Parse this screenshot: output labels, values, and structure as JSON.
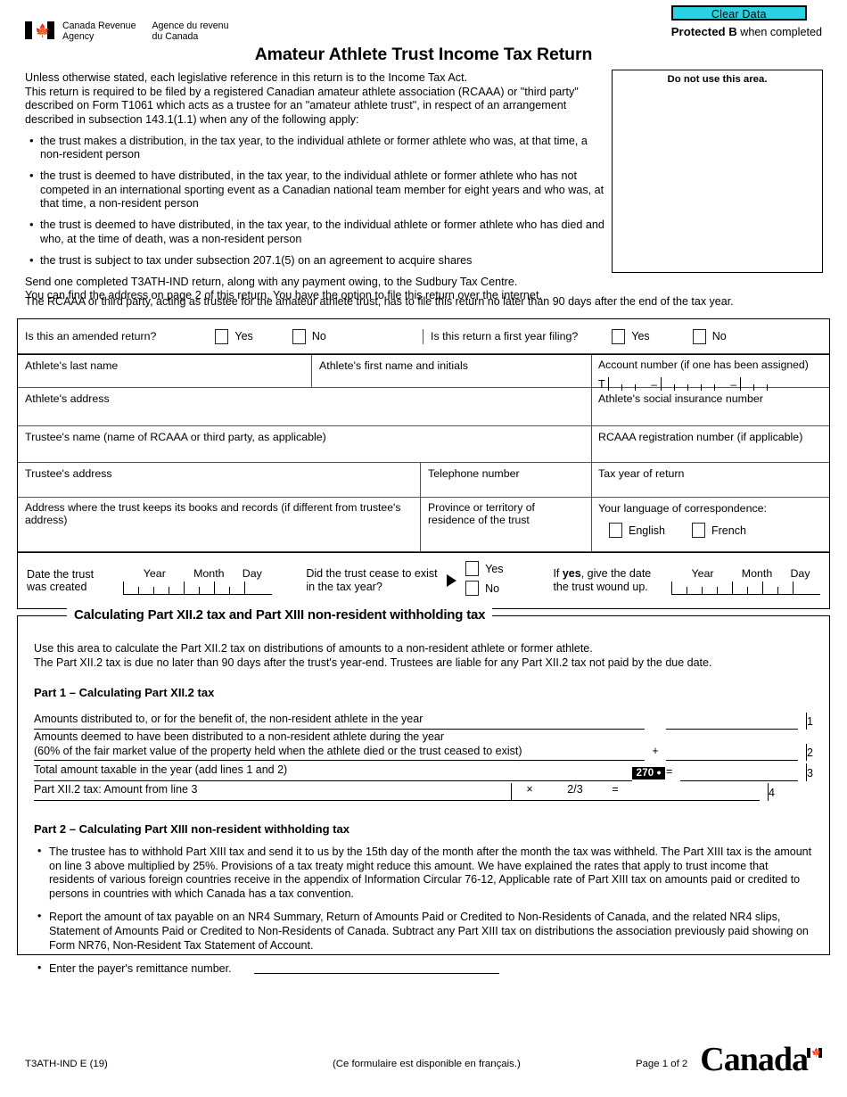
{
  "header": {
    "clear_data_label": "Clear Data",
    "clear_data_color": "#2ad2e3",
    "protected_bold": "Protected B",
    "protected_rest": " when completed",
    "agency_en_line1": "Canada Revenue",
    "agency_en_line2": "Agency",
    "agency_fr_line1": "Agence du revenu",
    "agency_fr_line2": "du Canada",
    "title": "Amateur Athlete Trust Income Tax Return"
  },
  "intro": {
    "line1": "Unless otherwise stated, each legislative reference in this return is to the Income Tax Act.",
    "line2": "This return is required to be filed by a registered Canadian amateur athlete association (RCAAA) or \"third party\" described on Form T1061 which acts as a trustee for an \"amateur athlete trust\", in respect of an arrangement described in subsection 143.1(1.1) when any of the following apply:",
    "bullets": [
      "the trust makes a distribution, in the tax year, to the individual athlete or former athlete who was, at that time, a non-resident person",
      "the trust is deemed to have distributed, in the tax year, to the individual athlete or former athlete who has not competed in an international sporting event as a Canadian national team member for eight years and who was, at that time, a non-resident person",
      "the trust is deemed to have distributed, in the tax year, to the individual athlete or former athlete who has died and who, at the time of death, was a non-resident person",
      "the trust is subject to tax under subsection 207.1(5) on an agreement to acquire shares"
    ],
    "send_line1": "Send one completed T3ATH-IND return, along with any payment owing, to the Sudbury Tax Centre.",
    "send_line2": "You can find the address on page 2 of this return. You have the option to file this return over the internet.",
    "rcaaa_line": "The RCAAA or third party, acting as trustee for the amateur athlete trust, has to file this return no later than 90 days after the end of the tax year."
  },
  "do_not_use": {
    "label": "Do not use this area."
  },
  "identification": {
    "amended_question": "Is this an amended return?",
    "amended_yes": "Yes",
    "amended_no": "No",
    "firstyear_question": "Is this return a first year filing?",
    "firstyear_yes": "Yes",
    "firstyear_no": "No",
    "athlete_last_name": "Athlete's last name",
    "athlete_first_name": "Athlete's first name and initials",
    "account_number": "Account number (if one has been assigned)",
    "account_prefix": "T",
    "account_dash": "–",
    "athlete_address": "Athlete's address",
    "athlete_sin": "Athlete's social insurance number",
    "trustee_name": "Trustee's name (name of RCAAA or third party, as applicable)",
    "rcaaa_reg_number": "RCAAA registration number (if applicable)",
    "trustee_address": "Trustee's address",
    "telephone_number": "Telephone number",
    "tax_year": "Tax year of return",
    "books_address": "Address where the trust keeps its books and records (if different from trustee's address)",
    "province_residence": "Province or territory of residence of the trust",
    "language_label": "Your language of correspondence:",
    "language_english": "English",
    "language_french": "French",
    "date_created_label": "Date the trust was created",
    "date_year": "Year",
    "date_month": "Month",
    "date_day": "Day",
    "cease_question": "Did the trust cease to exist in the tax year?",
    "cease_yes": "Yes",
    "cease_no": "No",
    "wound_up_bold": "If yes",
    "wound_up_rest": ", give the date the trust wound up.",
    "wound_up_line1_pre": "If ",
    "wound_up_line1_b": "yes",
    "wound_up_line1_post": ", give the date",
    "wound_up_line2": "the trust wound up."
  },
  "calc": {
    "legend": "Calculating Part XII.2 tax and Part XIII non-resident withholding tax",
    "intro_line1": "Use this area to calculate the Part XII.2 tax on distributions of amounts to a non-resident athlete or former athlete.",
    "intro_line2": "The Part XII.2 tax is due no later than 90 days after the trust's year-end. Trustees are liable for any Part XII.2 tax not paid by the due date.",
    "part1_heading": "Part 1 – Calculating Part XII.2 tax",
    "line1_text": "Amounts distributed to, or for the benefit of, the non-resident athlete in the year",
    "line1_no": "1",
    "line2_text_a": "Amounts deemed to have been distributed to a non-resident athlete during the year",
    "line2_text_b": "(60% of the fair market value of the property held when the athlete died or the trust ceased to exist)",
    "line2_op": "+",
    "line2_no": "2",
    "line3_text": "Total amount taxable in the year (add lines 1 and 2)",
    "line3_tag": "270",
    "line3_op": "=",
    "line3_no": "3",
    "line4_text": "Part XII.2 tax:  Amount from line 3",
    "line4_mult": "×",
    "line4_factor": "2/3",
    "line4_op": "=",
    "line4_no": "4",
    "part2_heading": "Part 2 – Calculating Part XIII non-resident withholding tax",
    "part2_bullets": [
      "The trustee has to withhold Part XIII tax and send it to us by the 15th day of the month after the month the tax was withheld. The Part XIII tax is the amount on line 3 above multiplied by 25%. Provisions of a tax treaty might reduce this amount. We have explained the rates that apply to trust income that residents of various foreign countries receive in the appendix of Information Circular 76-12, Applicable rate of Part XIII tax on amounts paid or credited to persons in countries with which Canada has a tax convention.",
      "Report the amount of tax payable on an NR4 Summary, Return of Amounts Paid or Credited to Non-Residents of Canada, and the related NR4 slips, Statement of Amounts Paid or Credited to Non-Residents of Canada. Subtract any Part XIII tax on distributions the association previously paid showing on Form NR76, Non-Resident Tax Statement of Account."
    ],
    "remittance_text": "Enter the payer's remittance number."
  },
  "footer": {
    "form_code": "T3ATH-IND E (19)",
    "french_note": "(Ce formulaire est disponible en français.)",
    "page_label": "Page 1 of 2",
    "wordmark": "Canada"
  }
}
